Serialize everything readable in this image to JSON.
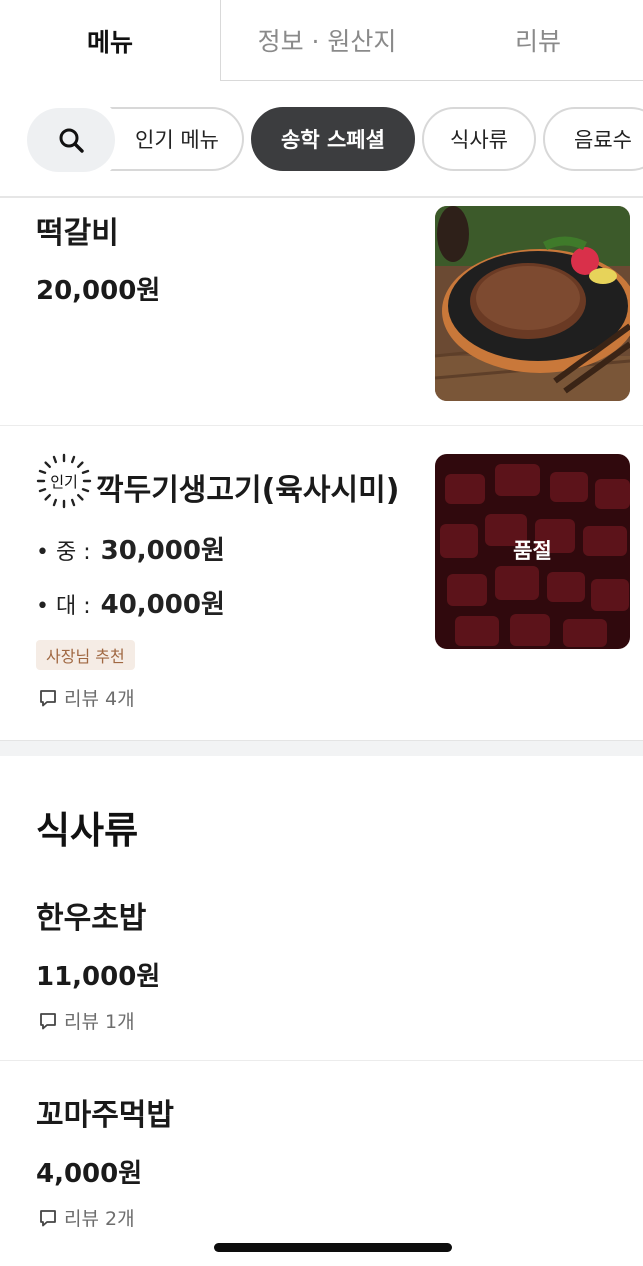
{
  "tabs": [
    "메뉴",
    "정보 · 원산지",
    "리뷰"
  ],
  "chips": [
    "인기 메뉴",
    "송학 스페셜",
    "식사류",
    "음료수"
  ],
  "items": [
    {
      "title": "떡갈비",
      "price": "20,000원"
    },
    {
      "badge": "인기",
      "title": "깍두기생고기(육사시미)",
      "options": [
        {
          "label": "• 중 :",
          "price": "30,000원"
        },
        {
          "label": "• 대 :",
          "price": "40,000원"
        }
      ],
      "tag": "사장님 추천",
      "review": "리뷰 4개",
      "soldout": "품절"
    }
  ],
  "section": {
    "title": "식사류",
    "items": [
      {
        "title": "한우초밥",
        "price": "11,000원",
        "review": "리뷰 1개"
      },
      {
        "title": "꼬마주먹밥",
        "price": "4,000원",
        "review": "리뷰 2개"
      }
    ]
  }
}
